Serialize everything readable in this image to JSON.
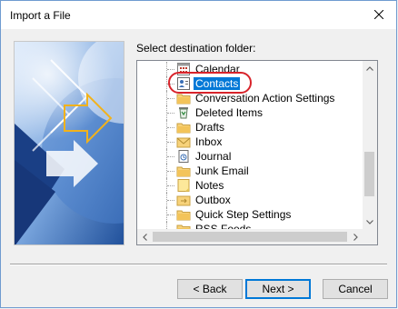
{
  "window": {
    "title": "Import a File",
    "close_icon": "close-icon"
  },
  "banner": {
    "icon": "import-wizard-arrows-graphic",
    "colors": {
      "dark": "#1f4f9a",
      "mid": "#3f74c1",
      "light": "#a9c7ee",
      "accent": "#f2b21b"
    }
  },
  "prompt": "Select destination folder:",
  "folders": [
    {
      "label": "Calendar",
      "icon": "calendar-icon",
      "selected": false
    },
    {
      "label": "Contacts",
      "icon": "contacts-icon",
      "selected": true
    },
    {
      "label": "Conversation Action Settings",
      "icon": "folder-icon",
      "selected": false
    },
    {
      "label": "Deleted Items",
      "icon": "recycle-bin-icon",
      "selected": false
    },
    {
      "label": "Drafts",
      "icon": "folder-icon",
      "selected": false
    },
    {
      "label": "Inbox",
      "icon": "inbox-icon",
      "selected": false
    },
    {
      "label": "Journal",
      "icon": "journal-icon",
      "selected": false
    },
    {
      "label": "Junk Email",
      "icon": "folder-icon",
      "selected": false
    },
    {
      "label": "Notes",
      "icon": "notes-icon",
      "selected": false
    },
    {
      "label": "Outbox",
      "icon": "outbox-icon",
      "selected": false
    },
    {
      "label": "Quick Step Settings",
      "icon": "folder-icon",
      "selected": false
    },
    {
      "label": "RSS Feeds",
      "icon": "folder-icon",
      "selected": false
    }
  ],
  "buttons": {
    "back": "< Back",
    "next": "Next >",
    "cancel": "Cancel"
  },
  "colors": {
    "selection": "#0078d7",
    "highlight_ring": "#d8232a"
  }
}
